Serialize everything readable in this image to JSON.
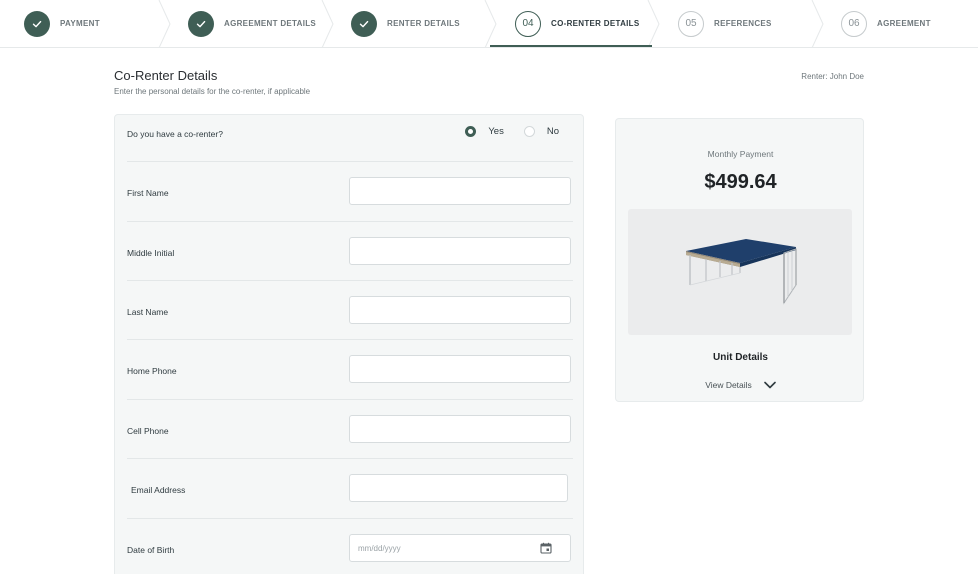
{
  "stepper": {
    "steps": [
      {
        "label": "PAYMENT",
        "state": "done",
        "number": ""
      },
      {
        "label": "AGREEMENT DETAILS",
        "state": "done",
        "number": ""
      },
      {
        "label": "RENTER DETAILS",
        "state": "done",
        "number": ""
      },
      {
        "label": "CO-RENTER DETAILS",
        "state": "active",
        "number": "04"
      },
      {
        "label": "REFERENCES",
        "state": "pending",
        "number": "05"
      },
      {
        "label": "AGREEMENT",
        "state": "pending",
        "number": "06"
      }
    ]
  },
  "header": {
    "title": "Co-Renter Details",
    "subtitle": "Enter the personal details for the co-renter, if applicable",
    "renter": "Renter: John Doe"
  },
  "form": {
    "co_renter_question": "Do you have a co-renter?",
    "yes_label": "Yes",
    "no_label": "No",
    "selected": "Yes",
    "first_name_label": "First Name",
    "first_name_value": "",
    "middle_initial_label": "Middle Initial",
    "middle_initial_value": "",
    "last_name_label": "Last Name",
    "last_name_value": "",
    "home_phone_label": "Home Phone",
    "home_phone_value": "",
    "cell_phone_label": "Cell Phone",
    "cell_phone_value": "",
    "email_label": "Email Address",
    "email_value": "",
    "dob_label": "Date of Birth",
    "dob_placeholder": "mm/dd/yyyy"
  },
  "payment": {
    "label": "Monthly Payment",
    "amount": "$499.64",
    "unit_title": "Unit Details",
    "view_details": "View Details"
  },
  "colors": {
    "accent": "#3f5e55",
    "roof": "#1f3f6b"
  },
  "icons": {
    "done_step": "check-icon",
    "date": "calendar-icon",
    "expand": "chevron-down-icon"
  }
}
